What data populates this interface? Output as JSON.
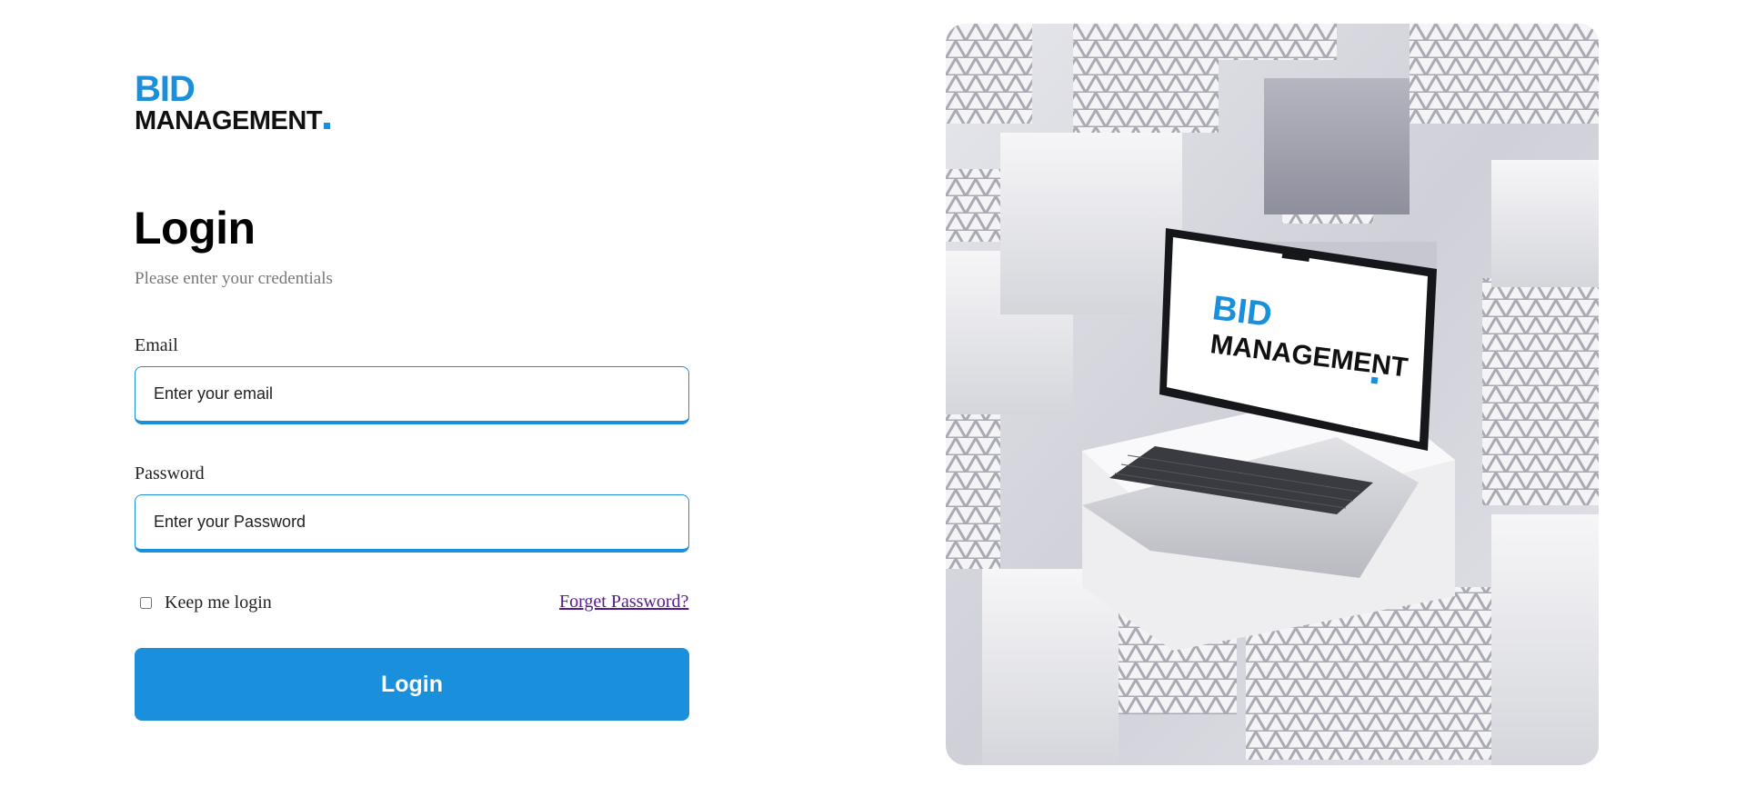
{
  "brand": {
    "line1": "BID",
    "line2": "MANAGEMENT",
    "accent_color": "#1a8fdc",
    "text_color": "#111111"
  },
  "login": {
    "title": "Login",
    "subtitle": "Please enter your credentials",
    "email_label": "Email",
    "email_placeholder": "Enter your email",
    "email_value": "",
    "password_label": "Password",
    "password_placeholder": "Enter your Password",
    "password_value": "",
    "keep_login_label": "Keep me login",
    "keep_login_checked": false,
    "forgot_password_label": "Forget Password?",
    "submit_label": "Login",
    "button_color": "#1a8fdc"
  },
  "hero": {
    "description_icon": "laptop-illustration",
    "screen_line1": "BID",
    "screen_line2": "MANAGEMENT"
  }
}
